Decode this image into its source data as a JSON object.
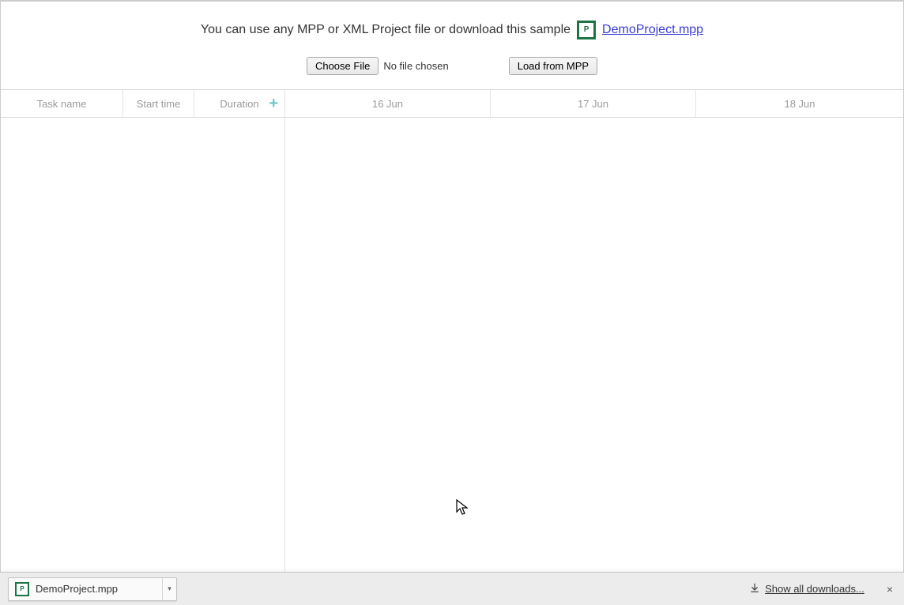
{
  "intro": {
    "text": "You can use any MPP or XML Project file or download this sample",
    "link_label": "DemoProject.mpp",
    "icon_name": "ms-project-icon",
    "icon_letter": "P"
  },
  "controls": {
    "choose_file_label": "Choose File",
    "file_status": "No file chosen",
    "load_label": "Load from MPP"
  },
  "grid": {
    "headers": {
      "task": "Task name",
      "start": "Start time",
      "duration": "Duration",
      "add_hint": "+"
    },
    "dates": [
      "16 Jun",
      "17 Jun",
      "18 Jun"
    ]
  },
  "downloads": {
    "chip_label": "DemoProject.mpp",
    "show_all_label": "Show all downloads...",
    "close_label": "×"
  }
}
